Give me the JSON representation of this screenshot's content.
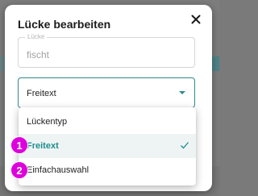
{
  "dialog": {
    "title": "Lücke bearbeiten",
    "close_icon": "close-icon"
  },
  "text_field": {
    "label": "Lücke",
    "value": "fischt"
  },
  "select": {
    "value": "Freitext",
    "caret_icon": "caret-down-icon"
  },
  "menu": {
    "header": "Lückentyp",
    "options": [
      {
        "label": "Freitext",
        "selected": true,
        "badge": "1"
      },
      {
        "label": "Einfachauswahl",
        "selected": false,
        "badge": "2"
      }
    ],
    "check_icon": "check-icon"
  },
  "colors": {
    "accent": "#2d8a8a",
    "badge": "#dd00dd",
    "selected_bg": "#eef4f4"
  }
}
